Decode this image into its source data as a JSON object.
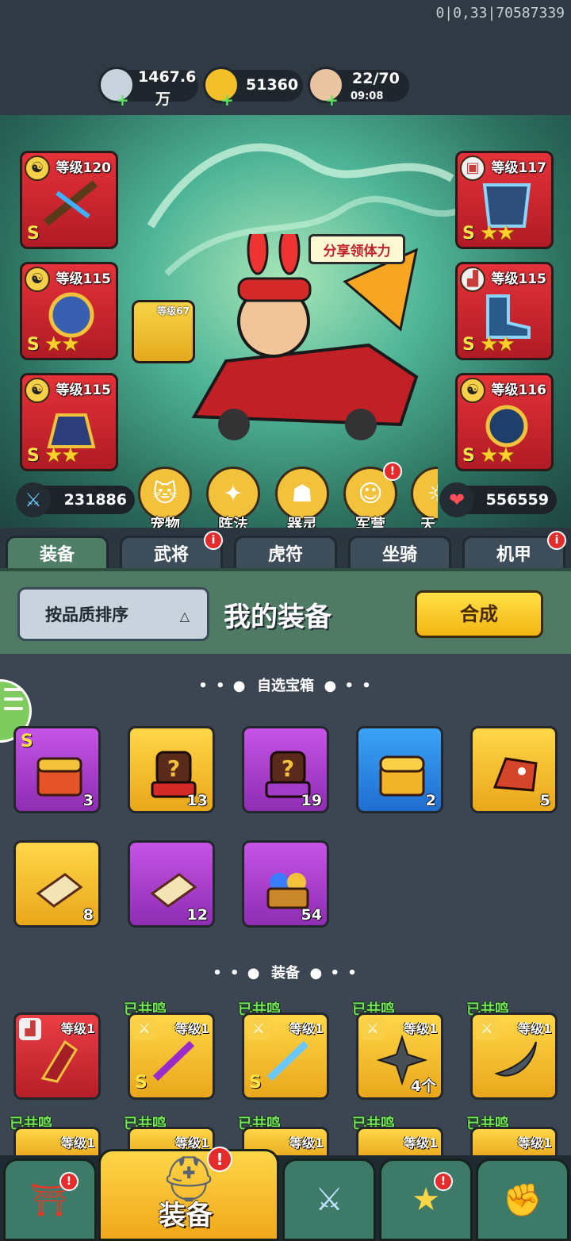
{
  "debug": "0|0,33|70587339",
  "resources": {
    "silver": {
      "value": "1467.6",
      "unit": "万"
    },
    "gold": {
      "value": "51360"
    },
    "stamina": {
      "value": "22/70",
      "timer": "09:08"
    }
  },
  "share_button": "分享领体力",
  "equip_slots": {
    "left": [
      {
        "level": "等级120",
        "grade": "S",
        "stars": ""
      },
      {
        "level": "等级115",
        "grade": "S",
        "stars": "★★"
      },
      {
        "level": "等级115",
        "grade": "S",
        "stars": "★★"
      }
    ],
    "right": [
      {
        "level": "等级117",
        "grade": "S",
        "stars": "★★"
      },
      {
        "level": "等级115",
        "grade": "S",
        "stars": "★★"
      },
      {
        "level": "等级116",
        "grade": "S",
        "stars": "★★"
      }
    ],
    "mount_small": "等级67"
  },
  "stats": {
    "attack": "231886",
    "hp": "556559"
  },
  "features": [
    "宠物",
    "阵法",
    "器灵",
    "军营",
    "天"
  ],
  "tabs": [
    "装备",
    "武将",
    "虎符",
    "坐骑",
    "机甲"
  ],
  "panel": {
    "sort_label": "按品质排序",
    "title": "我的装备",
    "combine": "合成"
  },
  "sections": {
    "chests": "自选宝箱",
    "equipment": "装备"
  },
  "chests_row1": [
    {
      "count": "3",
      "grade": "S",
      "color": "purple"
    },
    {
      "count": "13",
      "color": "gold"
    },
    {
      "count": "19",
      "color": "purple"
    },
    {
      "count": "2",
      "color": "blue"
    },
    {
      "count": "5",
      "color": "gold"
    }
  ],
  "chests_row2": [
    {
      "count": "8",
      "color": "gold"
    },
    {
      "count": "12",
      "color": "purple"
    },
    {
      "count": "54",
      "color": "purple"
    }
  ],
  "equip_row1": [
    {
      "level": "等级1",
      "resonance": "",
      "color": "red"
    },
    {
      "level": "等级1",
      "resonance": "已共鸣",
      "grade": "S",
      "color": "gold"
    },
    {
      "level": "等级1",
      "resonance": "已共鸣",
      "grade": "S",
      "color": "gold"
    },
    {
      "level": "等级1",
      "resonance": "已共鸣",
      "count": "4个",
      "color": "gold"
    },
    {
      "level": "等级1",
      "resonance": "已共鸣",
      "color": "gold"
    }
  ],
  "equip_row2": [
    {
      "level": "等级1",
      "resonance": "已共鸣"
    },
    {
      "level": "等级1",
      "resonance": "已共鸣"
    },
    {
      "level": "等级1",
      "resonance": "已共鸣"
    },
    {
      "level": "等级1",
      "resonance": "已共鸣"
    },
    {
      "level": "等级1",
      "resonance": "已共鸣"
    }
  ],
  "bottom_nav": {
    "active_label": "装备"
  },
  "colors": {
    "accent_green": "#4f7a64",
    "button_yellow": "#f3b512",
    "resonance_green": "#77e65c"
  }
}
